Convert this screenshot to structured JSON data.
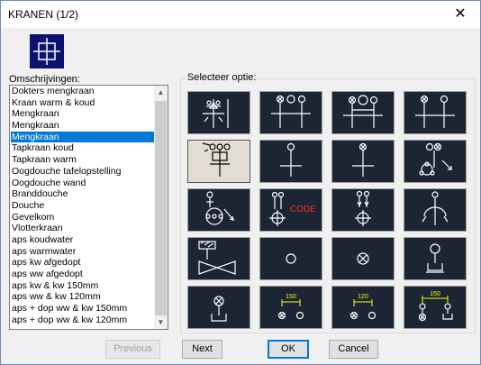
{
  "window": {
    "title": "KRANEN (1/2)",
    "close_glyph": "✕"
  },
  "list": {
    "label": "Omschrijvingen:",
    "selected_index": 4,
    "items": [
      "Dokters mengkraan",
      "Kraan warm & koud",
      "Mengkraan",
      "Mengkraan",
      "Mengkraan",
      "Tapkraan koud",
      "Tapkraan warm",
      "Oogdouche tafelopstelling",
      "Oogdouche wand",
      "Branddouche",
      "Douche",
      "Gevelkom",
      "Vlotterkraan",
      "aps koudwater",
      "aps warmwater",
      "aps kw afgedopt",
      "aps ww afgedopt",
      "aps kw & kw 150mm",
      "aps ww & kw 120mm",
      "aps + dop ww & kw 150mm",
      "aps + dop ww & kw 120mm"
    ]
  },
  "options": {
    "label": "Selecteer optie:",
    "selected_index": 4,
    "tile_labels": {
      "code": "CODE",
      "dim150": "150",
      "dim120": "120"
    }
  },
  "buttons": {
    "previous": "Previous",
    "next": "Next",
    "ok": "OK",
    "cancel": "Cancel"
  },
  "colors": {
    "tile_bg": "#1c2533",
    "tile_selected_bg": "#e4ddd4",
    "symbol": "#ffffff",
    "code_text": "#ff2a2a",
    "dimension": "#ffff00",
    "selection": "#0078d7",
    "logo_bg": "#0b1270"
  }
}
